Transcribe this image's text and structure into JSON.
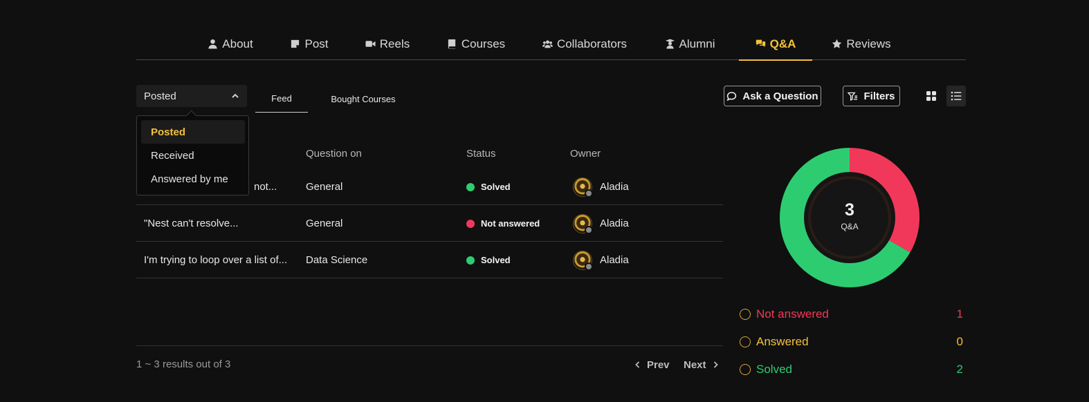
{
  "tabs": [
    {
      "label": "About",
      "icon": "user-icon"
    },
    {
      "label": "Post",
      "icon": "note-icon"
    },
    {
      "label": "Reels",
      "icon": "video-icon"
    },
    {
      "label": "Courses",
      "icon": "book-icon"
    },
    {
      "label": "Collaborators",
      "icon": "users-icon"
    },
    {
      "label": "Alumni",
      "icon": "graduate-icon"
    },
    {
      "label": "Q&A",
      "icon": "chat-bubbles-icon",
      "active": true
    },
    {
      "label": "Reviews",
      "icon": "star-icon"
    }
  ],
  "toolbar": {
    "select_value": "Posted",
    "subtabs": [
      "Feed",
      "Bought Courses"
    ],
    "ask_label": "Ask a Question",
    "filters_label": "Filters"
  },
  "dropdown": {
    "options": [
      "Posted",
      "Received",
      "Answered by me"
    ],
    "selected": "Posted"
  },
  "table": {
    "headers": {
      "question_on": "Question on",
      "status": "Status",
      "owner": "Owner"
    },
    "rows": [
      {
        "question": "not...",
        "question_on": "General",
        "status": "Solved",
        "owner": "Aladia"
      },
      {
        "question": "\"Nest can't resolve...",
        "question_on": "General",
        "status": "Not answered",
        "owner": "Aladia"
      },
      {
        "question": "I'm trying to loop over a list of...",
        "question_on": "Data Science",
        "status": "Solved",
        "owner": "Aladia"
      }
    ]
  },
  "footer": {
    "results": "1 ~ 3 results out of 3",
    "prev": "Prev",
    "next": "Next"
  },
  "stats": {
    "total": "3",
    "total_label": "Q&A",
    "legend": [
      {
        "label": "Not answered",
        "value": "1"
      },
      {
        "label": "Answered",
        "value": "0"
      },
      {
        "label": "Solved",
        "value": "2"
      }
    ]
  },
  "colors": {
    "accent": "#f3c13a",
    "solved": "#2ecc71",
    "not_answered": "#f2385a",
    "answered": "#f3c13a",
    "background": "#101010"
  }
}
